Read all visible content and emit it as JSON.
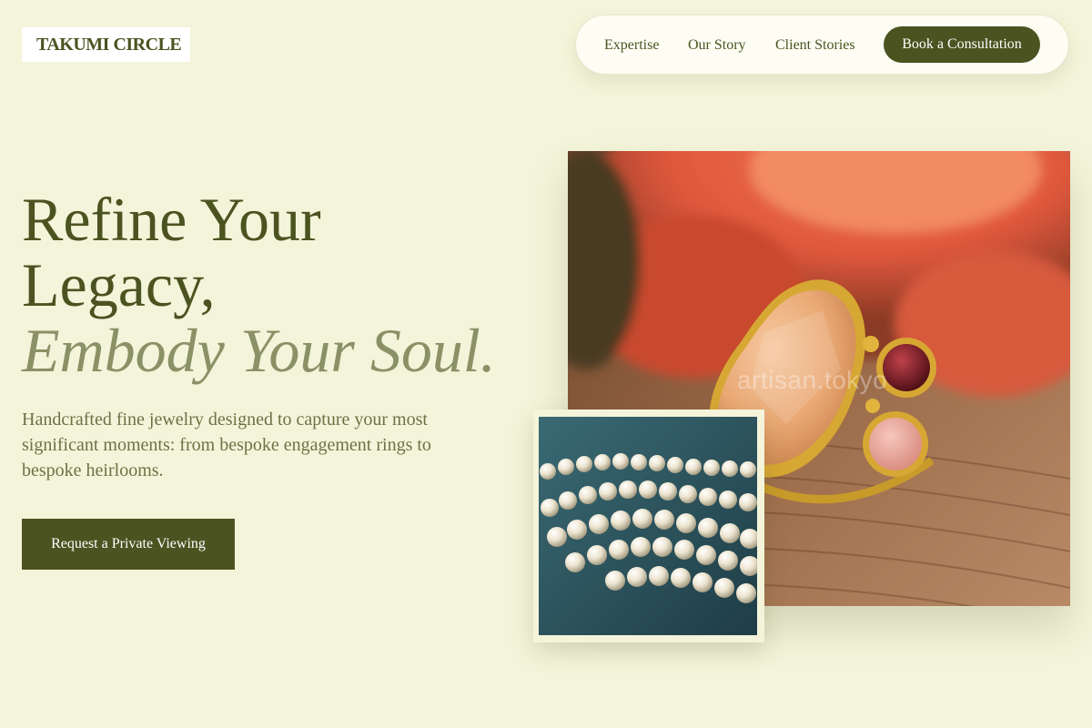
{
  "brand": {
    "logo_text": "TAKUMI CIRCLE"
  },
  "nav": {
    "links": [
      "Expertise",
      "Our Story",
      "Client Stories"
    ],
    "cta_label": "Book a Consultation"
  },
  "hero": {
    "headline_line1": "Refine Your",
    "headline_line2": "Legacy,",
    "headline_line3": "Embody Your Soul.",
    "subtext": "Handcrafted fine jewelry designed to capture your most significant moments: from bespoke engagement rings to bespoke heirlooms.",
    "cta_label": "Request a Private Viewing"
  },
  "images": {
    "main_watermark": "artisan.tokyo"
  },
  "colors": {
    "background": "#f4f4da",
    "primary": "#4b5320",
    "accent_text": "#8a9166",
    "body_text": "#6b7345"
  }
}
